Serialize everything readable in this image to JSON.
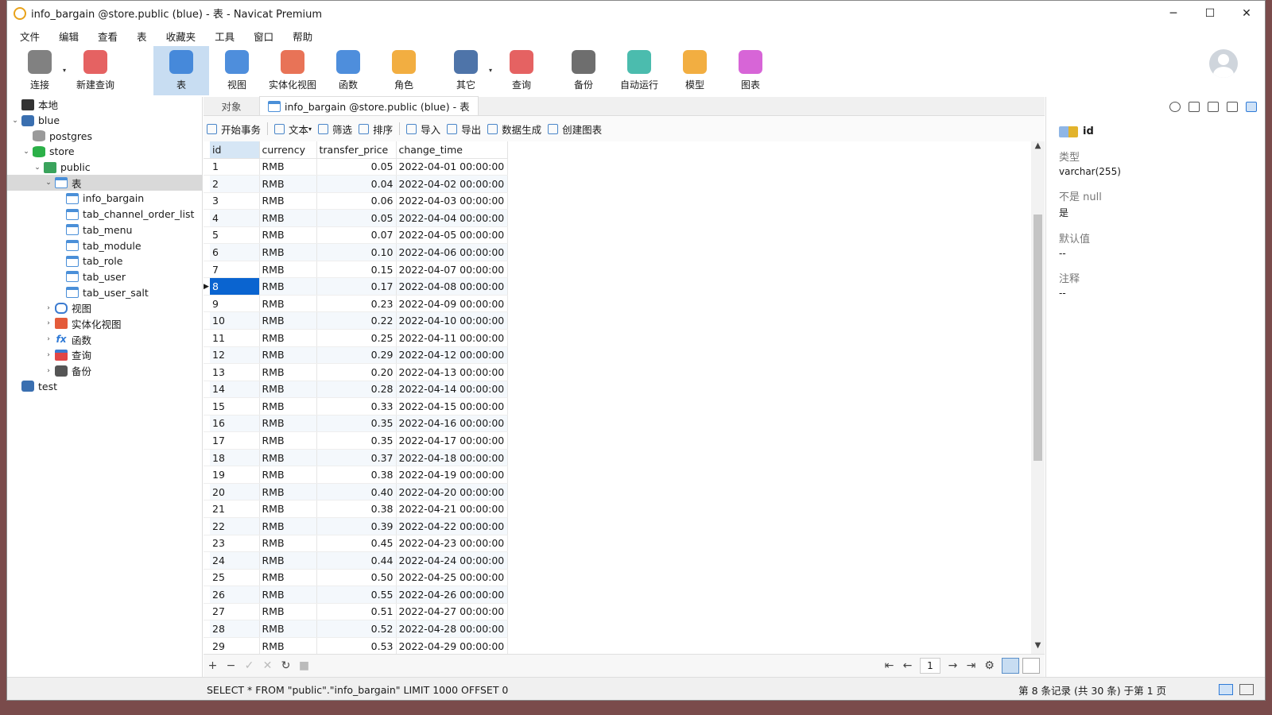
{
  "window": {
    "title": "info_bargain @store.public (blue) - 表 - Navicat Premium"
  },
  "menu": [
    "文件",
    "编辑",
    "查看",
    "表",
    "收藏夹",
    "工具",
    "窗口",
    "帮助"
  ],
  "toolbar": [
    {
      "label": "连接",
      "icon": "plug-icon",
      "color": "#6b6b6b"
    },
    {
      "label": "新建查询",
      "icon": "new-query-icon",
      "color": "#e04646"
    },
    {
      "label": "表",
      "icon": "table-icon",
      "color": "#2f7ad6"
    },
    {
      "label": "视图",
      "icon": "view-icon",
      "color": "#2f7ad6"
    },
    {
      "label": "实体化视图",
      "icon": "materialized-view-icon",
      "color": "#e45b3a"
    },
    {
      "label": "函数",
      "icon": "function-icon",
      "color": "#2f7ad6"
    },
    {
      "label": "角色",
      "icon": "role-icon",
      "color": "#f0a020"
    },
    {
      "label": "其它",
      "icon": "tools-icon",
      "color": "#2f5c9a"
    },
    {
      "label": "查询",
      "icon": "query-icon",
      "color": "#e04646"
    },
    {
      "label": "备份",
      "icon": "backup-icon",
      "color": "#555555"
    },
    {
      "label": "自动运行",
      "icon": "robot-icon",
      "color": "#2bb0a0"
    },
    {
      "label": "模型",
      "icon": "model-icon",
      "color": "#f0a020"
    },
    {
      "label": "图表",
      "icon": "chart-icon",
      "color": "#d04ad0"
    }
  ],
  "tree": [
    {
      "label": "本地",
      "indent": 0,
      "chev": "",
      "icon": "server"
    },
    {
      "label": "blue",
      "indent": 0,
      "chev": "⌄",
      "icon": "pg"
    },
    {
      "label": "postgres",
      "indent": 1,
      "chev": "",
      "icon": "db-grey"
    },
    {
      "label": "store",
      "indent": 1,
      "chev": "⌄",
      "icon": "db-green"
    },
    {
      "label": "public",
      "indent": 2,
      "chev": "⌄",
      "icon": "schema"
    },
    {
      "label": "表",
      "indent": 3,
      "chev": "⌄",
      "icon": "table",
      "selected": true
    },
    {
      "label": "info_bargain",
      "indent": 4,
      "chev": "",
      "icon": "table"
    },
    {
      "label": "tab_channel_order_list",
      "indent": 4,
      "chev": "",
      "icon": "table"
    },
    {
      "label": "tab_menu",
      "indent": 4,
      "chev": "",
      "icon": "table"
    },
    {
      "label": "tab_module",
      "indent": 4,
      "chev": "",
      "icon": "table"
    },
    {
      "label": "tab_role",
      "indent": 4,
      "chev": "",
      "icon": "table"
    },
    {
      "label": "tab_user",
      "indent": 4,
      "chev": "",
      "icon": "table"
    },
    {
      "label": "tab_user_salt",
      "indent": 4,
      "chev": "",
      "icon": "table"
    },
    {
      "label": "视图",
      "indent": 3,
      "chev": "›",
      "icon": "view"
    },
    {
      "label": "实体化视图",
      "indent": 3,
      "chev": "›",
      "icon": "mview"
    },
    {
      "label": "函数",
      "indent": 3,
      "chev": "›",
      "icon": "func"
    },
    {
      "label": "查询",
      "indent": 3,
      "chev": "›",
      "icon": "query"
    },
    {
      "label": "备份",
      "indent": 3,
      "chev": "›",
      "icon": "backup"
    },
    {
      "label": "test",
      "indent": 0,
      "chev": "",
      "icon": "pg"
    }
  ],
  "tabs": {
    "objects": "对象",
    "active": "info_bargain @store.public (blue) - 表"
  },
  "subtoolbar": [
    "开始事务",
    "文本",
    "筛选",
    "排序",
    "导入",
    "导出",
    "数据生成",
    "创建图表"
  ],
  "grid": {
    "columns": [
      "id",
      "currency",
      "transfer_price",
      "change_time"
    ],
    "current_row": 8,
    "rows": [
      [
        "1",
        "RMB",
        "0.05",
        "2022-04-01 00:00:00"
      ],
      [
        "2",
        "RMB",
        "0.04",
        "2022-04-02 00:00:00"
      ],
      [
        "3",
        "RMB",
        "0.06",
        "2022-04-03 00:00:00"
      ],
      [
        "4",
        "RMB",
        "0.05",
        "2022-04-04 00:00:00"
      ],
      [
        "5",
        "RMB",
        "0.07",
        "2022-04-05 00:00:00"
      ],
      [
        "6",
        "RMB",
        "0.10",
        "2022-04-06 00:00:00"
      ],
      [
        "7",
        "RMB",
        "0.15",
        "2022-04-07 00:00:00"
      ],
      [
        "8",
        "RMB",
        "0.17",
        "2022-04-08 00:00:00"
      ],
      [
        "9",
        "RMB",
        "0.23",
        "2022-04-09 00:00:00"
      ],
      [
        "10",
        "RMB",
        "0.22",
        "2022-04-10 00:00:00"
      ],
      [
        "11",
        "RMB",
        "0.25",
        "2022-04-11 00:00:00"
      ],
      [
        "12",
        "RMB",
        "0.29",
        "2022-04-12 00:00:00"
      ],
      [
        "13",
        "RMB",
        "0.20",
        "2022-04-13 00:00:00"
      ],
      [
        "14",
        "RMB",
        "0.28",
        "2022-04-14 00:00:00"
      ],
      [
        "15",
        "RMB",
        "0.33",
        "2022-04-15 00:00:00"
      ],
      [
        "16",
        "RMB",
        "0.35",
        "2022-04-16 00:00:00"
      ],
      [
        "17",
        "RMB",
        "0.35",
        "2022-04-17 00:00:00"
      ],
      [
        "18",
        "RMB",
        "0.37",
        "2022-04-18 00:00:00"
      ],
      [
        "19",
        "RMB",
        "0.38",
        "2022-04-19 00:00:00"
      ],
      [
        "20",
        "RMB",
        "0.40",
        "2022-04-20 00:00:00"
      ],
      [
        "21",
        "RMB",
        "0.38",
        "2022-04-21 00:00:00"
      ],
      [
        "22",
        "RMB",
        "0.39",
        "2022-04-22 00:00:00"
      ],
      [
        "23",
        "RMB",
        "0.45",
        "2022-04-23 00:00:00"
      ],
      [
        "24",
        "RMB",
        "0.44",
        "2022-04-24 00:00:00"
      ],
      [
        "25",
        "RMB",
        "0.50",
        "2022-04-25 00:00:00"
      ],
      [
        "26",
        "RMB",
        "0.55",
        "2022-04-26 00:00:00"
      ],
      [
        "27",
        "RMB",
        "0.51",
        "2022-04-27 00:00:00"
      ],
      [
        "28",
        "RMB",
        "0.52",
        "2022-04-28 00:00:00"
      ],
      [
        "29",
        "RMB",
        "0.53",
        "2022-04-29 00:00:00"
      ]
    ]
  },
  "pager": {
    "page": "1"
  },
  "properties": {
    "field": "id",
    "items": [
      {
        "label": "类型",
        "value": "varchar(255)"
      },
      {
        "label": "不是 null",
        "value": "是"
      },
      {
        "label": "默认值",
        "value": "--"
      },
      {
        "label": "注释",
        "value": "--"
      }
    ]
  },
  "status": {
    "sql": "SELECT * FROM \"public\".\"info_bargain\" LIMIT 1000 OFFSET 0",
    "records": "第 8 条记录 (共 30 条) 于第 1 页"
  }
}
